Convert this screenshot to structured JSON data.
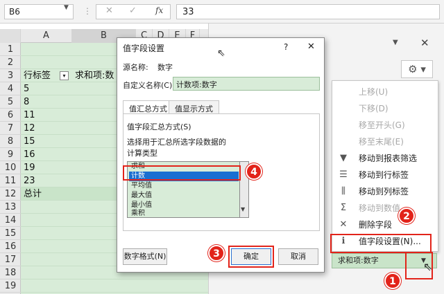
{
  "formula_bar": {
    "name_box": "B6",
    "fx": "fx",
    "formula": "33"
  },
  "sheet": {
    "columns": [
      "A",
      "B",
      "C",
      "D",
      "E",
      "F"
    ],
    "rows": [
      "1",
      "2",
      "3",
      "4",
      "5",
      "6",
      "7",
      "8",
      "9",
      "10",
      "11",
      "12",
      "13",
      "14",
      "15",
      "16",
      "17",
      "18",
      "19"
    ],
    "cells": [
      {
        "row": "3",
        "a": "行标签",
        "b": "求和项:数"
      },
      {
        "row": "4",
        "a": "5"
      },
      {
        "row": "5",
        "a": "8"
      },
      {
        "row": "6",
        "a": "11"
      },
      {
        "row": "7",
        "a": "12"
      },
      {
        "row": "8",
        "a": "15"
      },
      {
        "row": "9",
        "a": "16"
      },
      {
        "row": "10",
        "a": "19"
      },
      {
        "row": "11",
        "a": "23"
      },
      {
        "row": "12",
        "a": "总计"
      }
    ]
  },
  "dialog": {
    "title": "值字段设置",
    "help": "?",
    "close": "✕",
    "source_label": "源名称:",
    "source_value": "数字",
    "custom_label": "自定义名称(C):",
    "custom_value": "计数项:数字",
    "tabs": [
      "值汇总方式",
      "值显示方式"
    ],
    "group_label": "值字段汇总方式(S)",
    "desc": "选择用于汇总所选字段数据的",
    "calc_type": "计算类型",
    "options": [
      "求和",
      "计数",
      "平均值",
      "最大值",
      "最小值",
      "乘积"
    ],
    "selected_option": "计数",
    "number_format": "数字格式(N)",
    "ok": "确定",
    "cancel": "取消"
  },
  "context_menu": {
    "items": [
      {
        "label": "上移(U)",
        "enabled": false,
        "icon": ""
      },
      {
        "label": "下移(D)",
        "enabled": false,
        "icon": ""
      },
      {
        "label": "移至开头(G)",
        "enabled": false,
        "icon": ""
      },
      {
        "label": "移至末尾(E)",
        "enabled": false,
        "icon": ""
      },
      {
        "label": "移动到报表筛选",
        "enabled": true,
        "icon": "filter-icon"
      },
      {
        "label": "移动到行标签",
        "enabled": true,
        "icon": "rows-icon"
      },
      {
        "label": "移动到列标签",
        "enabled": true,
        "icon": "columns-icon"
      },
      {
        "label": "移动到数值",
        "enabled": false,
        "icon": "sigma-icon"
      },
      {
        "label": "删除字段",
        "enabled": true,
        "icon": "delete-icon"
      },
      {
        "label": "值字段设置(N)...",
        "enabled": true,
        "icon": "field-settings-icon"
      }
    ],
    "field_chip": "求和项:数字"
  },
  "badges": [
    "1",
    "2",
    "3",
    "4"
  ],
  "colors": {
    "accent_red": "#e2231a",
    "selection_blue": "#1a6fd1",
    "pivot_green": "#d8ecd8"
  }
}
